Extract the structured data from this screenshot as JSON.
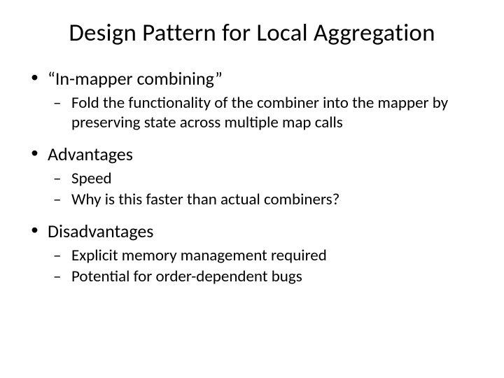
{
  "title": "Design Pattern for Local Aggregation",
  "bullets": [
    {
      "text": "“In-mapper combining”",
      "sub": [
        "Fold the functionality of the combiner into the mapper by preserving state across multiple map calls"
      ]
    },
    {
      "text": "Advantages",
      "sub": [
        "Speed",
        "Why is this faster than actual combiners?"
      ]
    },
    {
      "text": "Disadvantages",
      "sub": [
        "Explicit memory management required",
        "Potential for order-dependent bugs"
      ]
    }
  ]
}
